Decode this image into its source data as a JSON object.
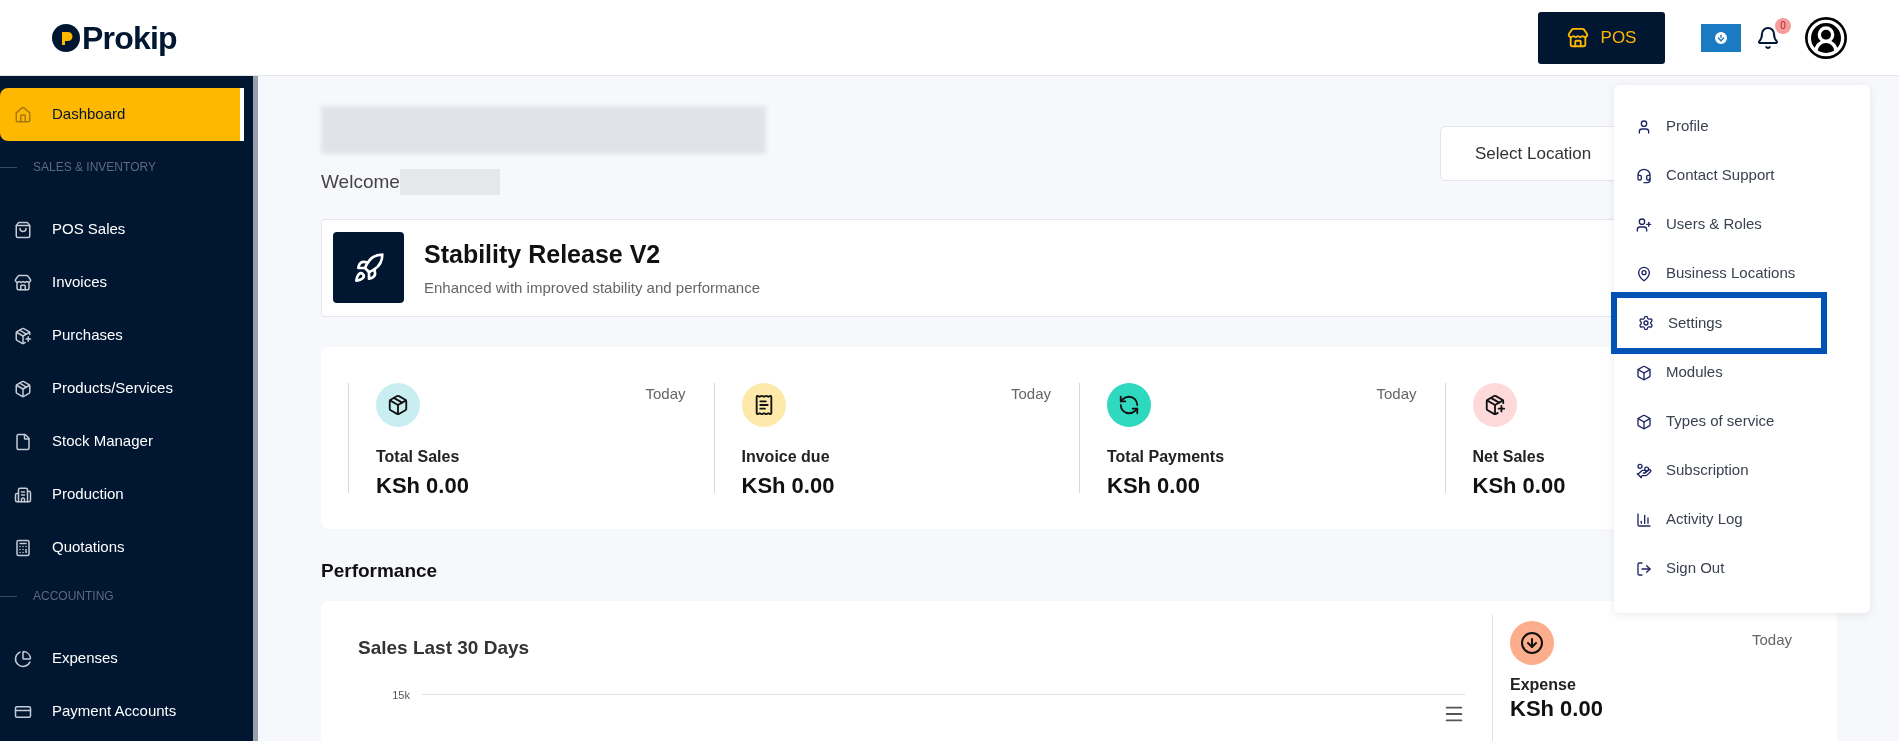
{
  "header": {
    "logo_text": "Prokip",
    "pos_button": "POS",
    "notification_count": "0"
  },
  "sidebar": {
    "items": [
      {
        "kind": "item",
        "label": "Dashboard",
        "selected": true
      },
      {
        "kind": "section",
        "label": "SALES & INVENTORY"
      },
      {
        "kind": "item",
        "label": "POS Sales",
        "selected": false
      },
      {
        "kind": "item",
        "label": "Invoices",
        "selected": false
      },
      {
        "kind": "item",
        "label": "Purchases",
        "selected": false
      },
      {
        "kind": "item",
        "label": "Products/Services",
        "selected": false
      },
      {
        "kind": "item",
        "label": "Stock Manager",
        "selected": false
      },
      {
        "kind": "item",
        "label": "Production",
        "selected": false
      },
      {
        "kind": "item",
        "label": "Quotations",
        "selected": false
      },
      {
        "kind": "section",
        "label": "ACCOUNTING"
      },
      {
        "kind": "item",
        "label": "Expenses",
        "selected": false
      },
      {
        "kind": "item",
        "label": "Payment Accounts",
        "selected": false
      }
    ]
  },
  "page": {
    "welcome": "Welcome",
    "location_button": "Select Location",
    "release": {
      "title": "Stability Release V2",
      "subtitle": "Enhanced with improved stability and performance"
    },
    "stats": [
      {
        "label": "Total Sales",
        "period": "Today",
        "value": "KSh 0.00",
        "color": "#c9eef2"
      },
      {
        "label": "Invoice due",
        "period": "Today",
        "value": "KSh 0.00",
        "color": "#fde9a9"
      },
      {
        "label": "Total Payments",
        "period": "Today",
        "value": "KSh 0.00",
        "color": "#2fd9c0"
      },
      {
        "label": "Net Sales",
        "value": "KSh 0.00",
        "color": "#fdd9d9"
      }
    ],
    "performance_heading": "Performance",
    "chart": {
      "title": "Sales Last 30 Days",
      "tick": "15k"
    },
    "expense": {
      "period": "Today",
      "label": "Expense",
      "value": "KSh 0.00"
    }
  },
  "user_menu": {
    "items": [
      {
        "label": "Profile",
        "selected": false
      },
      {
        "label": "Contact Support",
        "selected": false
      },
      {
        "label": "Users & Roles",
        "selected": false
      },
      {
        "label": "Business Locations",
        "selected": false
      },
      {
        "label": "Settings",
        "selected": true
      },
      {
        "label": "Modules",
        "selected": false
      },
      {
        "label": "Types of service",
        "selected": false
      },
      {
        "label": "Subscription",
        "selected": false
      },
      {
        "label": "Activity Log",
        "selected": false
      },
      {
        "label": "Sign Out",
        "selected": false
      }
    ]
  }
}
